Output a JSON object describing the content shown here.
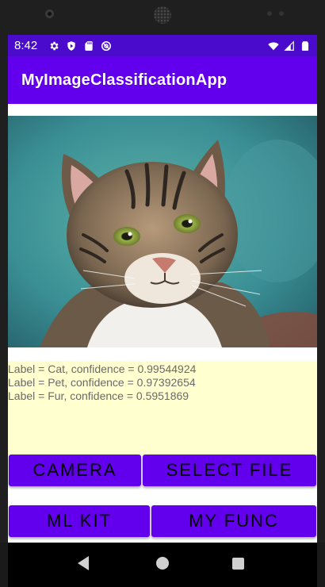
{
  "status_bar": {
    "time": "8:42",
    "left_icons": [
      "gear-icon",
      "shield-play-icon",
      "sd-card-icon",
      "at-sign-icon"
    ],
    "right_icons": [
      "wifi-icon",
      "cellular-signal-icon",
      "battery-icon"
    ]
  },
  "app_bar": {
    "title": "MyImageClassificationApp",
    "color": "#6200ee"
  },
  "image": {
    "subject": "tabby cat photo"
  },
  "results": {
    "lines": [
      "Label = Cat, confidence = 0.99544924",
      "Label = Pet, confidence = 0.97392654",
      "Label = Fur, confidence = 0.5951869"
    ],
    "background": "#ffffd0"
  },
  "buttons": {
    "camera": "CAMERA",
    "select_file": "SELECT FILE",
    "ml_kit": "ML KIT",
    "my_func": "MY FUNC"
  },
  "nav": {
    "icons": [
      "back-icon",
      "home-icon",
      "recents-icon"
    ]
  }
}
